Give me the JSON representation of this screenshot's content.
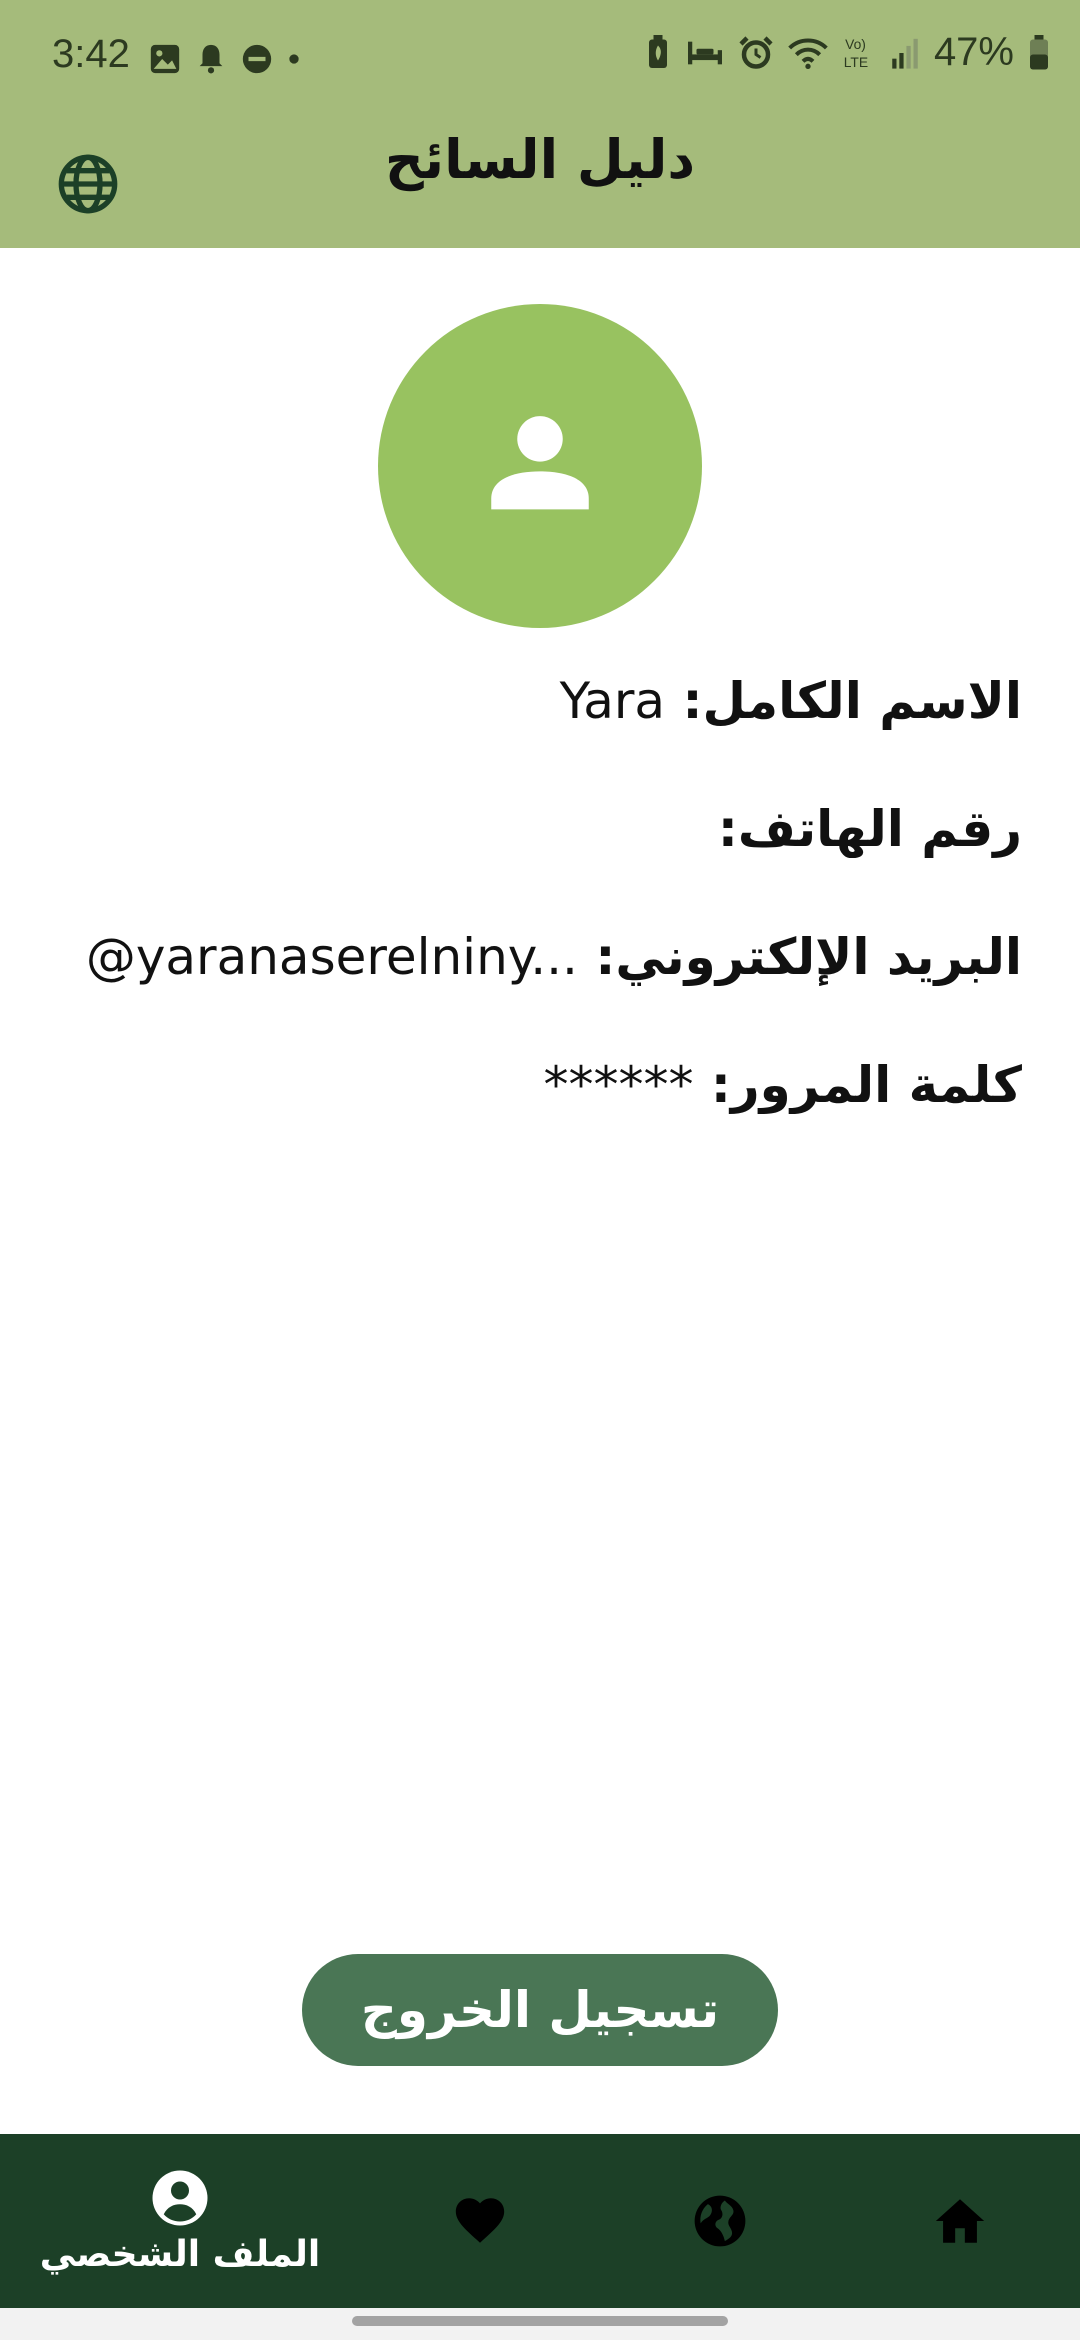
{
  "status_bar": {
    "time": "3:42",
    "battery": "47%",
    "network": "LTE"
  },
  "app_bar": {
    "title": "دليل السائح",
    "language_icon": "globe-icon"
  },
  "profile": {
    "avatar_icon": "person-icon",
    "full_name_label": "الاسم الكامل:",
    "full_name_value": "Yara",
    "phone_label": "رقم الهاتف:",
    "phone_value": "",
    "email_label": "البريد الإلكتروني:",
    "email_value": "@yaranaserelniny...",
    "password_label": "كلمة المرور:",
    "password_value": "******"
  },
  "actions": {
    "logout_label": "تسجيل الخروج"
  },
  "bottom_nav": {
    "profile_label": "الملف الشخصي",
    "items": [
      "account-circle-icon",
      "heart-icon",
      "globe-icon",
      "home-icon"
    ]
  },
  "colors": {
    "app_bar": "#a5bb7b",
    "avatar": "#98c260",
    "logout_button": "#4a7655",
    "bottom_nav": "#1c4027"
  }
}
